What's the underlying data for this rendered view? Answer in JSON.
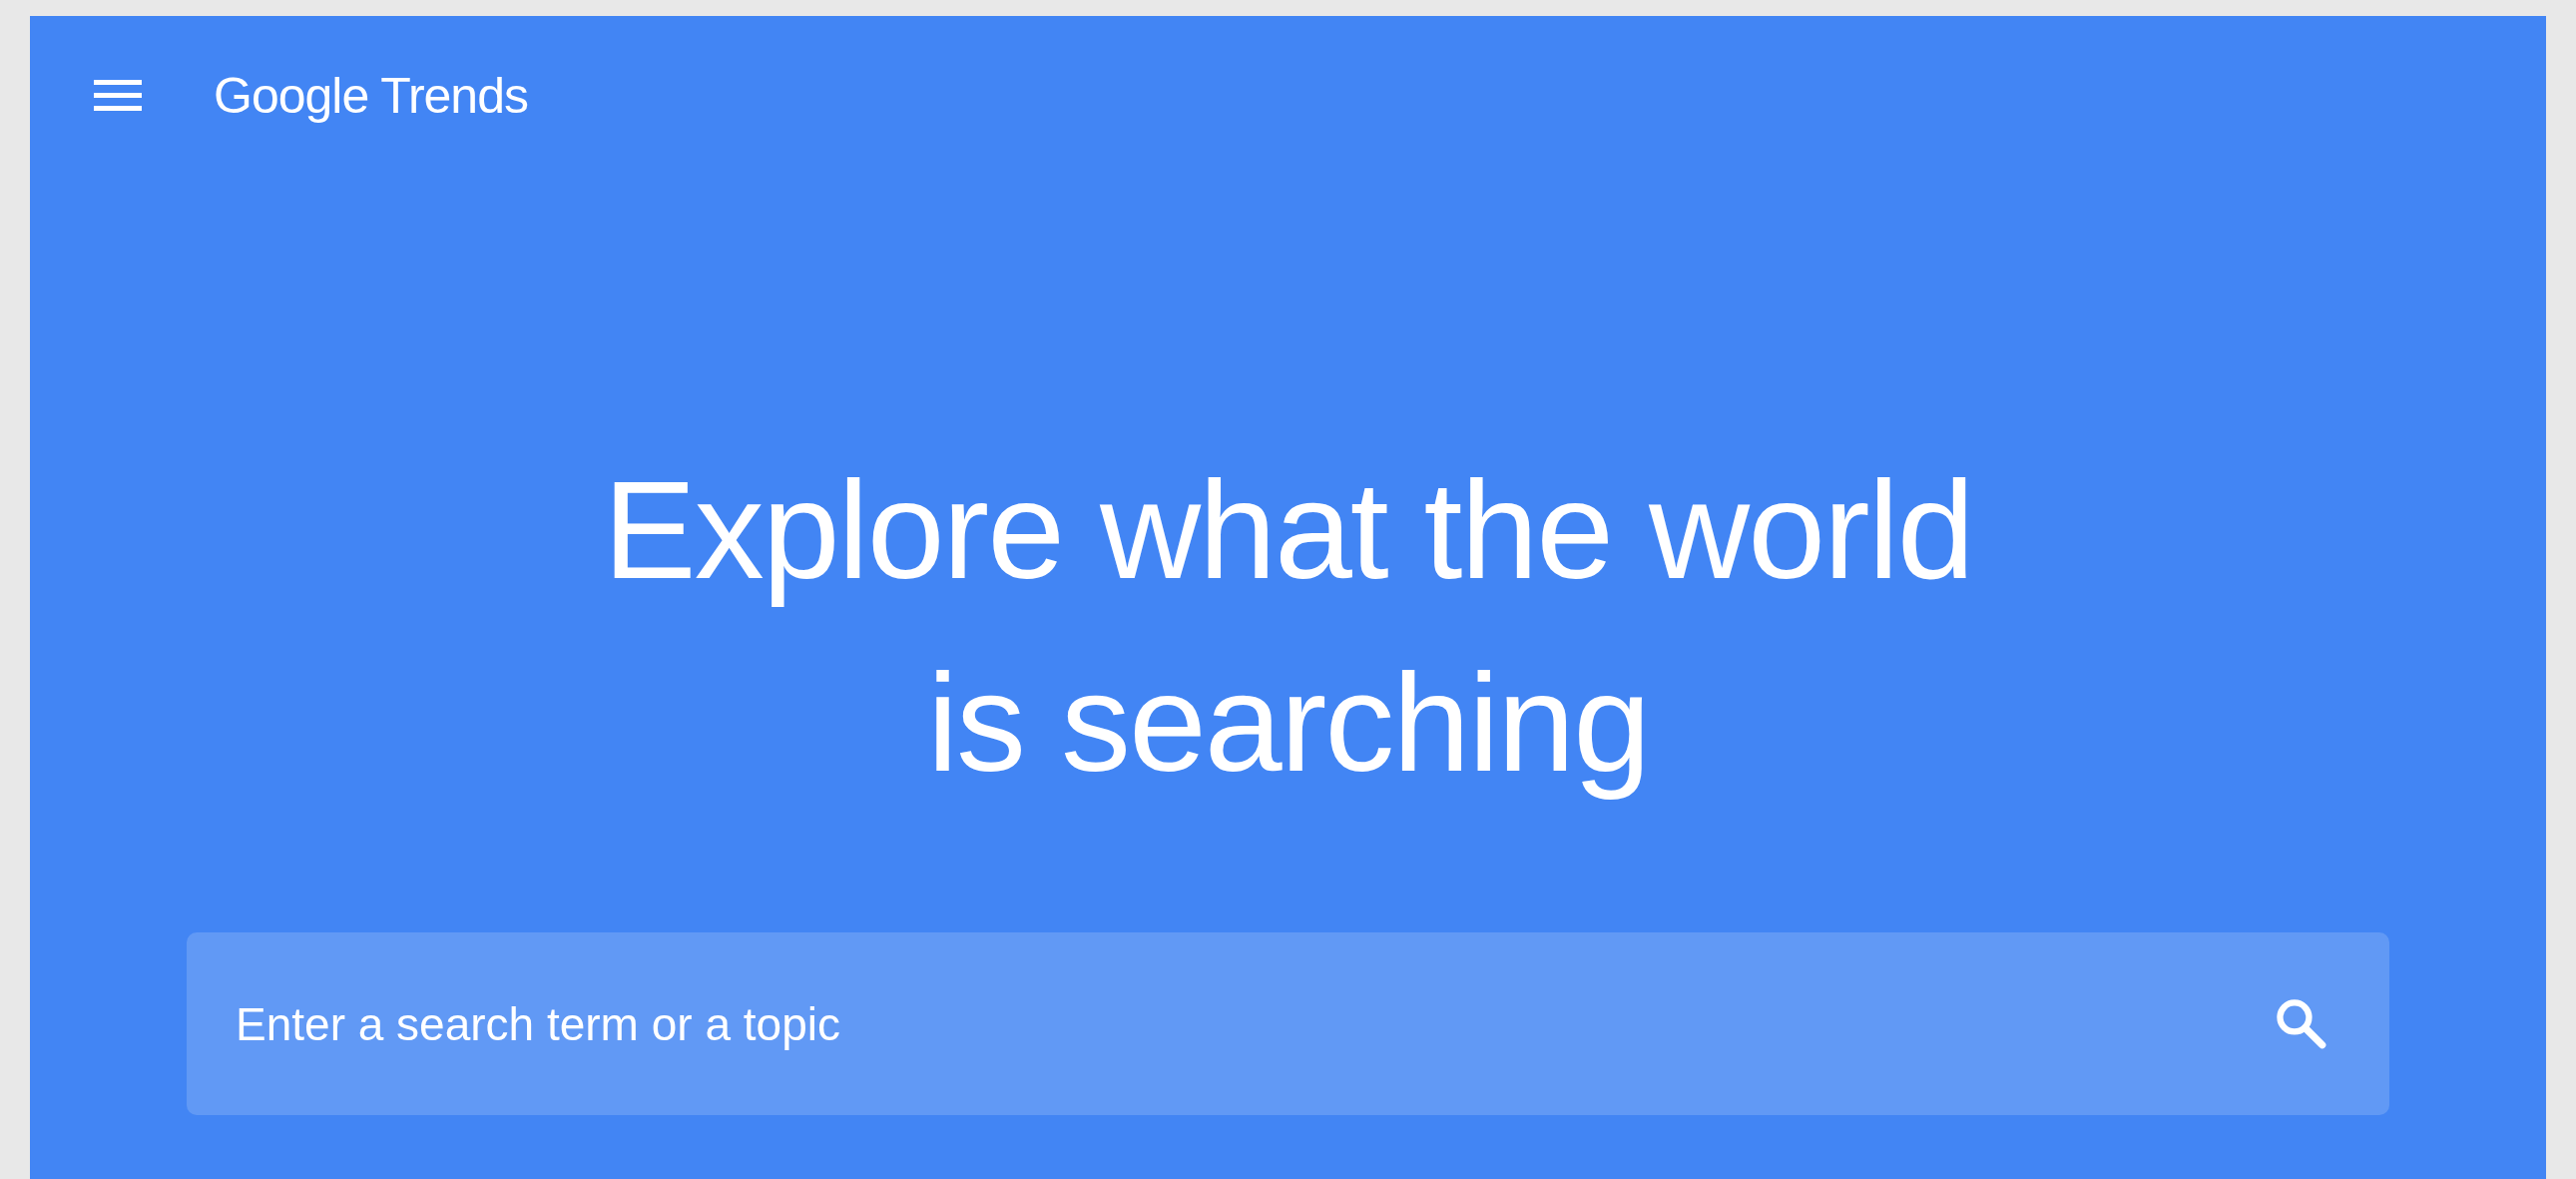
{
  "header": {
    "logo": "Google Trends"
  },
  "hero": {
    "title_lines": [
      "Explore what the world",
      "is searching"
    ]
  },
  "search": {
    "placeholder": "Enter a search term or a topic"
  }
}
